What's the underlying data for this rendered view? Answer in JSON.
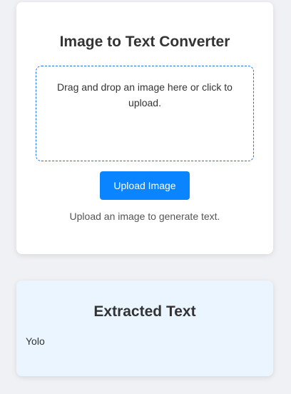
{
  "uploader": {
    "title": "Image to Text Converter",
    "dropzone_text": "Drag and drop an image here or click to upload.",
    "upload_button_label": "Upload Image",
    "status_text": "Upload an image to generate text."
  },
  "result": {
    "title": "Extracted Text",
    "text": "Yolo"
  },
  "colors": {
    "background": "#f0f1f5",
    "card": "#ffffff",
    "accent": "#0a84ff",
    "dropzone_border": "#1a73e8",
    "result_background": "#eaf5ff"
  }
}
